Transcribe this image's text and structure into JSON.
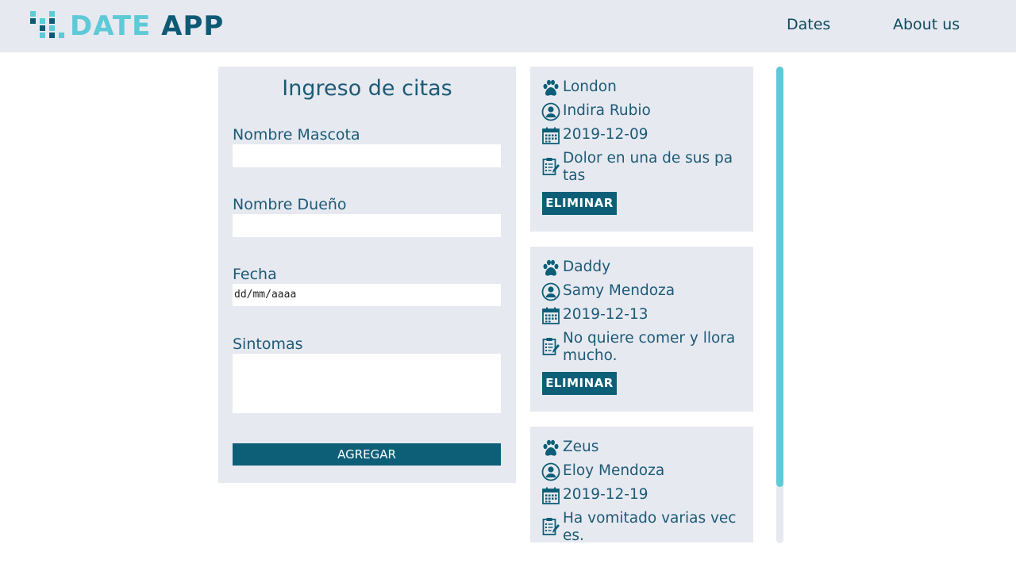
{
  "brand": {
    "part1": "DATE",
    "part2": "APP",
    "color_light": "#5ec9d7",
    "color_dark": "#0d5a75"
  },
  "nav": {
    "dates": "Dates",
    "about": "About us"
  },
  "form": {
    "title": "Ingreso de citas",
    "pet_label": "Nombre Mascota",
    "owner_label": "Nombre Dueño",
    "date_label": "Fecha",
    "date_placeholder": "dd/mm/aaaa",
    "symptoms_label": "Sintomas",
    "submit": "AGREGAR"
  },
  "appointments": [
    {
      "pet": "London",
      "owner": "Indira Rubio",
      "date": "2019-12-09",
      "symptom_line1": "Dolor en una de sus pa",
      "symptom_line2": "tas",
      "delete": "ELIMINAR"
    },
    {
      "pet": "Daddy",
      "owner": "Samy Mendoza",
      "date": "2019-12-13",
      "symptom_line1": "No quiere comer y llora",
      "symptom_line2": "mucho.",
      "delete": "ELIMINAR"
    },
    {
      "pet": "Zeus",
      "owner": "Eloy Mendoza",
      "date": "2019-12-19",
      "symptom_line1": "Ha vomitado varias vec",
      "symptom_line2": "es."
    }
  ],
  "icons": {
    "pet": "paw-icon",
    "owner": "user-icon",
    "date": "calendar-icon",
    "symptoms": "clipboard-icon"
  }
}
